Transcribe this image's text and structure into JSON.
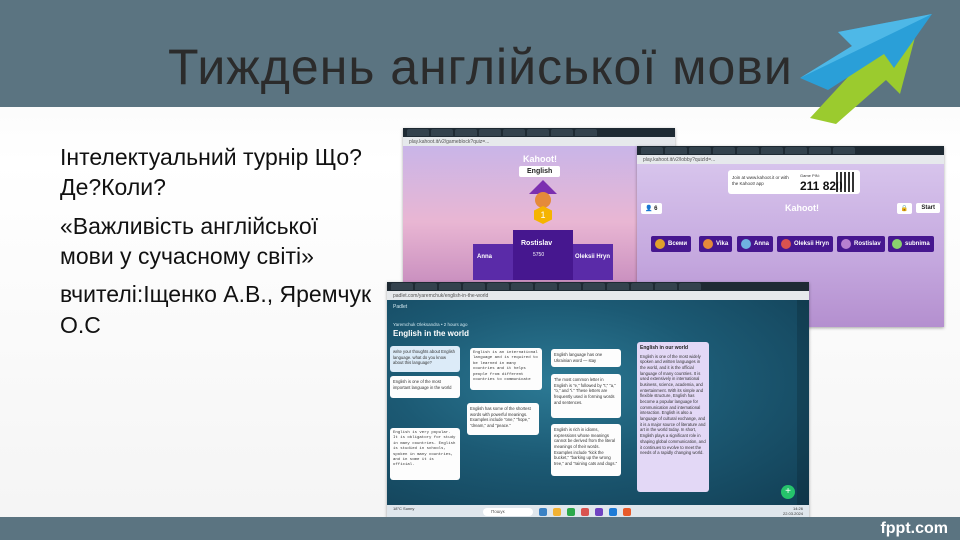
{
  "slide": {
    "title": "Тиждень англійської мови",
    "paragraphs": [
      "Інтелектуальний турнір Що?Де?Коли?",
      "«Важливість англійської мови у сучасному світі»",
      "вчителі:Іщенко А.В., Яремчук О.С"
    ],
    "footer_logo": "fppt.com"
  },
  "colors": {
    "header_band": "#5b7481",
    "arrow_blue": "#2a9fd8",
    "arrow_green": "#9bcb2e",
    "kahoot_purple": "#46178f",
    "padlet_teal": "#1c5a74"
  },
  "shot_kahoot_podium": {
    "url": "play.kahoot.it/v2/gameblock?quiz=...",
    "logo": "Kahoot!",
    "quiz_label": "English",
    "winner_rank": "1",
    "winner_name": "Rostislav",
    "winner_score": "5750",
    "left_name": "Anna",
    "right_name": "Oleksii Hryn"
  },
  "shot_kahoot_lobby": {
    "url": "play.kahoot.it/v2/lobby?quizId=...",
    "join_text": "Join at www.kahoot.it or with the Kahoot! app",
    "pin_label": "Game PIN:",
    "pin": "211 820",
    "logo": "Kahoot!",
    "player_count": "6",
    "start_label": "Start",
    "players": [
      "Всеми",
      "Vika",
      "Anna",
      "Oleksii Hryn",
      "Rostislav",
      "subnima"
    ]
  },
  "shot_padlet": {
    "url": "padlet.com/yaremchuk/english-in-the-world",
    "brand": "Padlet",
    "subtitle": "Yaremchuk Oleksandra • 2 hours ago",
    "title": "English in the world",
    "fab": "+",
    "cards": [
      {
        "title": "",
        "text": "write your thoughts about English language. what do you know about this language?",
        "style": "blue"
      },
      {
        "title": "",
        "text": "English is one of the most important language in the world",
        "style": ""
      },
      {
        "title": "",
        "text": "English is very popular. It is obligatory for study in many countries. English is studied in schools, spoken in many countries, and in some it is official.",
        "style": "mono"
      },
      {
        "title": "",
        "text": "English is an international language and is required to be learned in many countries and it helps people from different countries to communicate",
        "style": "mono"
      },
      {
        "title": "",
        "text": "English has some of the shortest words with powerful meanings. Examples include \"one,\" \"hope,\" \"dream,\" and \"peace.\"",
        "style": ""
      },
      {
        "title": "",
        "text": "English language has one Ukrainian word — stay",
        "style": ""
      },
      {
        "title": "",
        "text": "The most common letter in English is \"e,\" followed by \"t,\" \"a,\" \"o,\" and \"i.\" These letters are frequently used in forming words and sentences.",
        "style": ""
      },
      {
        "title": "",
        "text": "English is rich in idioms, expressions whose meanings cannot be derived from the literal meanings of their words. Examples include \"kick the bucket,\" \"barking up the wrong tree,\" and \"raining cats and dogs.\"",
        "style": ""
      },
      {
        "title": "English in our world",
        "text": "English is one of the most widely spoken and written languages in the world, and it is the official language of many countries. It is used extensively in international business, science, academia, and entertainment. With its simple and flexible structure, English has become a popular language for communication and international interaction. English is also a language of cultural exchange, and it is a major source of literature and art in the world today. In short, English plays a significant role in shaping global communication, and it continues to evolve to meet the needs of a rapidly changing world.",
        "style": "purple"
      }
    ],
    "taskbar": {
      "weather": "18°C Sunny",
      "search": "Пошук",
      "time": "14:26",
      "date": "22.03.2024"
    }
  }
}
